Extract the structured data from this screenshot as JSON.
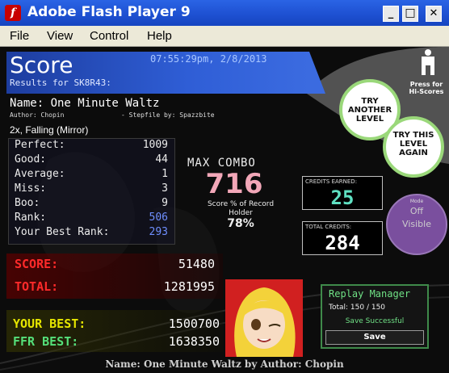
{
  "window": {
    "title": "Adobe Flash Player 9",
    "minimize": "_",
    "maximize": "□",
    "close": "✕"
  },
  "menu": [
    "File",
    "View",
    "Control",
    "Help"
  ],
  "header": {
    "title": "Score",
    "timestamp": "07:55:29pm, 2/8/2013",
    "subtitle": "Results for SK8R43:"
  },
  "song": {
    "name": "Name: One Minute Waltz",
    "author": "Author: Chopin",
    "stepfile": "- Stepfile by: Spazzbite",
    "modifier": "2x, Falling (Mirror)"
  },
  "stats": [
    {
      "label": "Perfect:",
      "value": "1009"
    },
    {
      "label": "Good:",
      "value": "44"
    },
    {
      "label": "Average:",
      "value": "1"
    },
    {
      "label": "Miss:",
      "value": "3"
    },
    {
      "label": "Boo:",
      "value": "9"
    },
    {
      "label": "Rank:",
      "value": "506"
    },
    {
      "label": "Your Best Rank:",
      "value": "293"
    }
  ],
  "combo": {
    "label": "MAX COMBO",
    "value": "716",
    "record_label": "Score % of Record Holder",
    "record_value": "78%"
  },
  "credits": {
    "earned_label": "CREDITS EARNED:",
    "earned_value": "25",
    "total_label": "TOTAL CREDITS:",
    "total_value": "284"
  },
  "mode": {
    "label": "Mode",
    "state": "Off",
    "value": "Visible"
  },
  "buttons": {
    "try_another": "TRY ANOTHER LEVEL",
    "try_again": "TRY THIS LEVEL AGAIN",
    "press_for": "Press for",
    "hi_scores": "Hi-Scores"
  },
  "scores": {
    "score_label": "SCORE:",
    "score_value": "51480",
    "total_label": "TOTAL:",
    "total_value": "1281995",
    "best_label": "YOUR BEST:",
    "best_value": "1500700",
    "ffr_label": "FFR BEST:",
    "ffr_value": "1638350"
  },
  "replay": {
    "title": "Replay Manager",
    "total": "Total: 150 / 150",
    "status": "Save Successful",
    "save": "Save"
  },
  "footer": "Name:  One  Minute  Waltz  by  Author:  Chopin",
  "colors": {
    "accent": "#3f6fdb",
    "green": "#55e07a",
    "score_red": "#ff2a2a",
    "best_yellow": "#e6e600",
    "purple": "#7a4f9e"
  }
}
